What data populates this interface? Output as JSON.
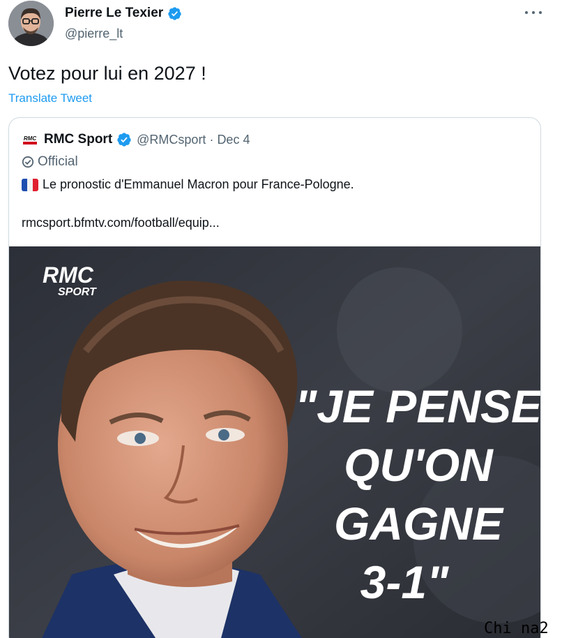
{
  "author": {
    "name": "Pierre Le Texier",
    "handle": "@pierre_lt",
    "verified": true,
    "avatar_icon": "person-avatar"
  },
  "tweet": {
    "text": "Votez pour lui en 2027 !",
    "translate_label": "Translate Tweet"
  },
  "quoted_tweet": {
    "name": "RMC Sport",
    "handle": "@RMCsport",
    "separator": "·",
    "date": "Dec 4",
    "label": "Official",
    "flag_icon": "france-flag",
    "text": "Le pronostic d'Emmanuel Macron pour France-Pologne.",
    "link": "rmcsport.bfmtv.com/football/equip..."
  },
  "media": {
    "logo_line1": "RMC",
    "logo_line2": "SPORT",
    "quote_lines": [
      "\"JE PENSE",
      "QU'ON",
      "GAGNE",
      "3-1\""
    ]
  },
  "watermark": "Chi na2",
  "colors": {
    "verified_blue": "#1d9bf0",
    "link_blue": "#1d9bf0",
    "secondary_text": "#536471",
    "card_border": "#cfd9de"
  }
}
